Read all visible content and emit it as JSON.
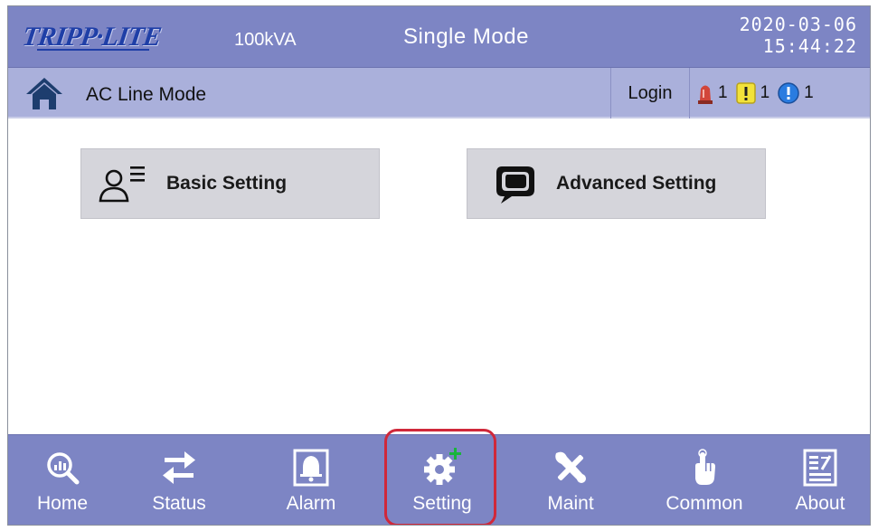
{
  "header": {
    "logo_text": "TRIPP·LITE",
    "capacity": "100kVA",
    "mode": "Single Mode",
    "date": "2020-03-06",
    "time": "15:44:22"
  },
  "status": {
    "line_mode": "AC Line Mode",
    "login_label": "Login",
    "alarms": [
      {
        "type": "critical",
        "icon": "siren-icon",
        "count": "1",
        "color": "#d2463a"
      },
      {
        "type": "warning",
        "icon": "exclamation-icon",
        "count": "1",
        "color": "#f2e23a"
      },
      {
        "type": "info",
        "icon": "info-icon",
        "count": "1",
        "color": "#2a7ce0"
      }
    ]
  },
  "menu": {
    "basic_label": "Basic Setting",
    "advanced_label": "Advanced Setting"
  },
  "nav": {
    "selected": "Setting",
    "items": [
      {
        "label": "Home",
        "icon": "magnifier-chart-icon"
      },
      {
        "label": "Status",
        "icon": "swap-arrows-icon"
      },
      {
        "label": "Alarm",
        "icon": "bell-icon"
      },
      {
        "label": "Setting",
        "icon": "gear-plus-icon"
      },
      {
        "label": "Maint",
        "icon": "tools-icon"
      },
      {
        "label": "Common",
        "icon": "hand-pointer-icon"
      },
      {
        "label": "About",
        "icon": "document-icon"
      }
    ]
  },
  "colors": {
    "header_bg": "#7d85c4",
    "status_bg": "#aab0db",
    "button_bg": "#d5d5db",
    "highlight_ring": "#d0283a",
    "logo_blue": "#1f3fa7",
    "plus_green": "#19b43c"
  }
}
